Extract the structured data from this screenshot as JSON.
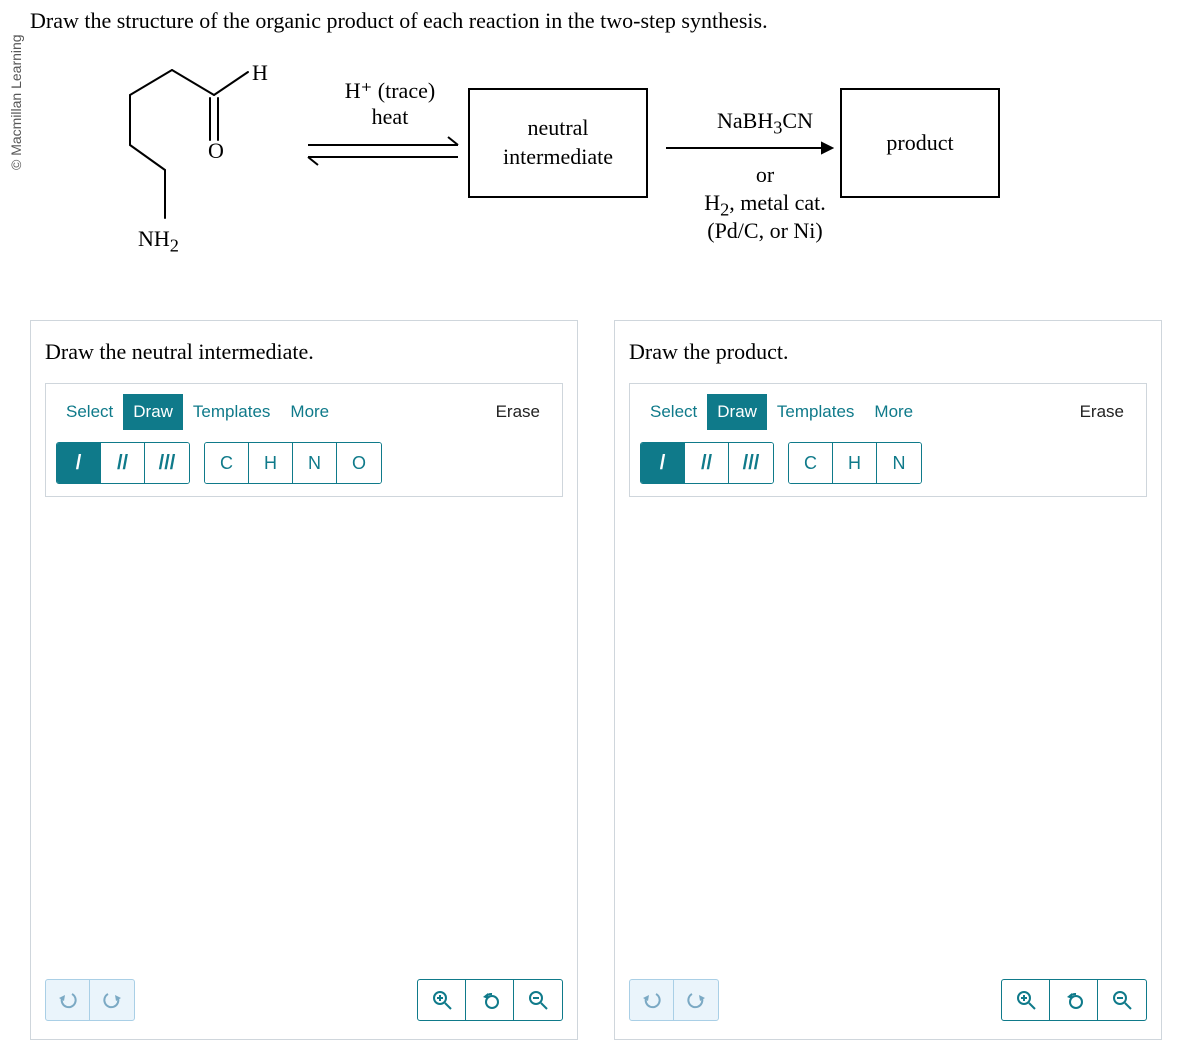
{
  "copyright": "© Macmillan Learning",
  "question": "Draw the structure of the organic product of each reaction in the two-step synthesis.",
  "scheme": {
    "hLabel": "H",
    "nh2": "NH",
    "nh2sub": "2",
    "step1_a": "H⁺ (trace)",
    "step1_b": "heat",
    "box1": "neutral\nintermediate",
    "reagent2a": "NaBH",
    "reagent2a_sub": "3",
    "reagent2a_tail": "CN",
    "or": "or",
    "reagent2b": "H",
    "reagent2b_sub": "2",
    "reagent2b_tail": ", metal cat.",
    "reagent2c": "(Pd/C, or Ni)",
    "box2": "product"
  },
  "panels": [
    {
      "title": "Draw the neutral intermediate.",
      "tabs": [
        "Select",
        "Draw",
        "Templates",
        "More"
      ],
      "active_tab": 1,
      "erase": "Erase",
      "bonds": [
        "/",
        "//",
        "///"
      ],
      "active_bond": 0,
      "atoms": [
        "C",
        "H",
        "N",
        "O"
      ]
    },
    {
      "title": "Draw the product.",
      "tabs": [
        "Select",
        "Draw",
        "Templates",
        "More"
      ],
      "active_tab": 1,
      "erase": "Erase",
      "bonds": [
        "/",
        "//",
        "///"
      ],
      "active_bond": 0,
      "atoms": [
        "C",
        "H",
        "N"
      ]
    }
  ]
}
